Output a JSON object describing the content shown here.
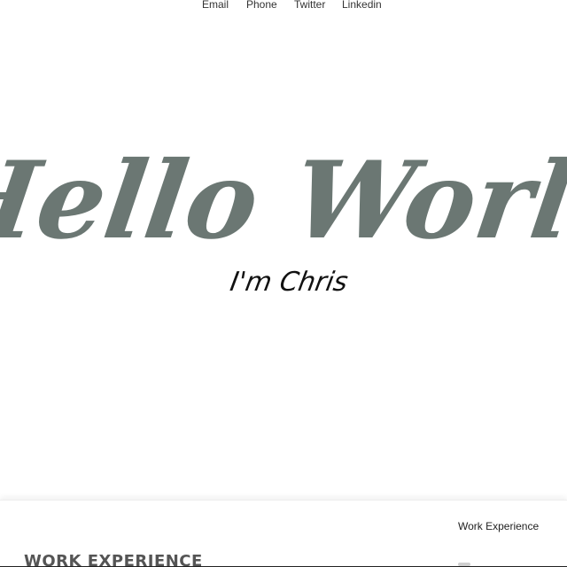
{
  "nav": {
    "links": [
      {
        "label": "Email"
      },
      {
        "label": "Phone"
      },
      {
        "label": "Twitter"
      },
      {
        "label": "Linkedin"
      }
    ]
  },
  "hero": {
    "title": "Hello World",
    "subtitle": "I'm Chris"
  },
  "work_section": {
    "heading": "WORK EXPERIENCE",
    "side_nav_label": "Work Experience"
  },
  "colors": {
    "title_color": "#6b7773",
    "subtitle_color": "#111111",
    "nav_text": "#333333"
  }
}
